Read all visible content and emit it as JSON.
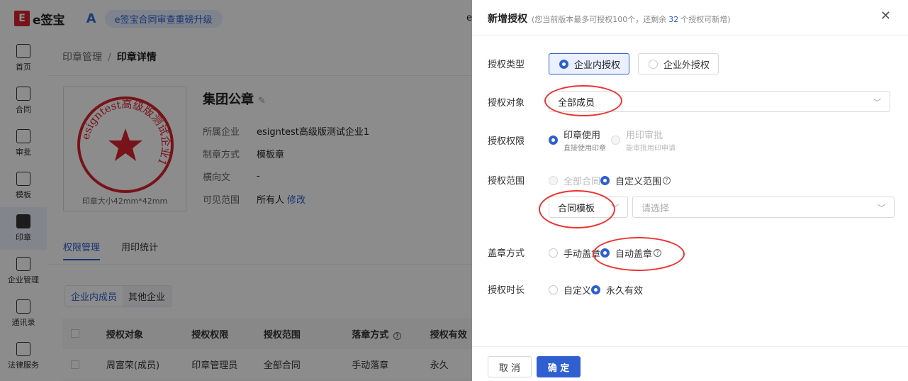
{
  "app": {
    "logo_mark": "E",
    "logo_text": "e签宝",
    "announcement": "e签宝合同审查重磅升级",
    "top_right_fragment": "e"
  },
  "sidebar": [
    {
      "label": "首页",
      "icon": "home-icon"
    },
    {
      "label": "合同",
      "icon": "contract-icon"
    },
    {
      "label": "审批",
      "icon": "approval-icon"
    },
    {
      "label": "模板",
      "icon": "template-icon"
    },
    {
      "label": "印章",
      "icon": "seal-icon",
      "active": true
    },
    {
      "label": "企业管理",
      "icon": "enterprise-icon"
    },
    {
      "label": "通讯录",
      "icon": "contacts-icon"
    },
    {
      "label": "法律服务",
      "icon": "legal-icon"
    }
  ],
  "breadcrumb": {
    "parent": "印章管理",
    "sep": "/",
    "current": "印章详情"
  },
  "seal": {
    "name": "集团公章",
    "size_caption": "印章大小42mm*42mm",
    "ring_text": "esigntest高级版测试企业1",
    "info": [
      {
        "k": "所属企业",
        "v": "esigntest高级版测试企业1"
      },
      {
        "k": "制章方式",
        "v": "模板章"
      },
      {
        "k": "横向文",
        "v": "-"
      },
      {
        "k": "可见范围",
        "v": "所有人",
        "link": "修改"
      }
    ]
  },
  "tabs": [
    "权限管理",
    "用印统计"
  ],
  "subtabs": [
    "企业内成员",
    "其他企业"
  ],
  "table": {
    "headers": [
      "授权对象",
      "授权权限",
      "授权范围",
      "落章方式",
      "授权有效"
    ],
    "rows": [
      [
        "周富荣(成员)",
        "印章管理员",
        "全部合同",
        "手动落章",
        "永久"
      ]
    ]
  },
  "drawer": {
    "title": "新增授权",
    "note_prefix": "(您当前版本最多可授权100个，还剩余",
    "note_count": "32",
    "note_suffix": "个授权可新增)",
    "close": "✕",
    "auth_type": {
      "label": "授权类型",
      "options": [
        "企业内授权",
        "企业外授权"
      ],
      "selected": "企业内授权"
    },
    "auth_target": {
      "label": "授权对象",
      "value": "全部成员"
    },
    "auth_perm": {
      "label": "授权权限",
      "opt1": "印章使用",
      "opt1_sub": "直接使用印章",
      "opt2": "用印审批",
      "opt2_sub": "能审批用印申请"
    },
    "auth_scope": {
      "label": "授权范围",
      "opt1": "全部合同",
      "opt2": "自定义范围",
      "select1": "合同模板",
      "select2_placeholder": "请选择"
    },
    "stamp_mode": {
      "label": "盖章方式",
      "opt1": "手动盖章",
      "opt2": "自动盖章"
    },
    "duration": {
      "label": "授权时长",
      "opt1": "自定义",
      "opt2": "永久有效"
    },
    "cancel": "取 消",
    "ok": "确 定"
  },
  "colors": {
    "accent": "#2f5fd0",
    "brand_red": "#d9232e",
    "annotation_red": "#ee3333"
  }
}
